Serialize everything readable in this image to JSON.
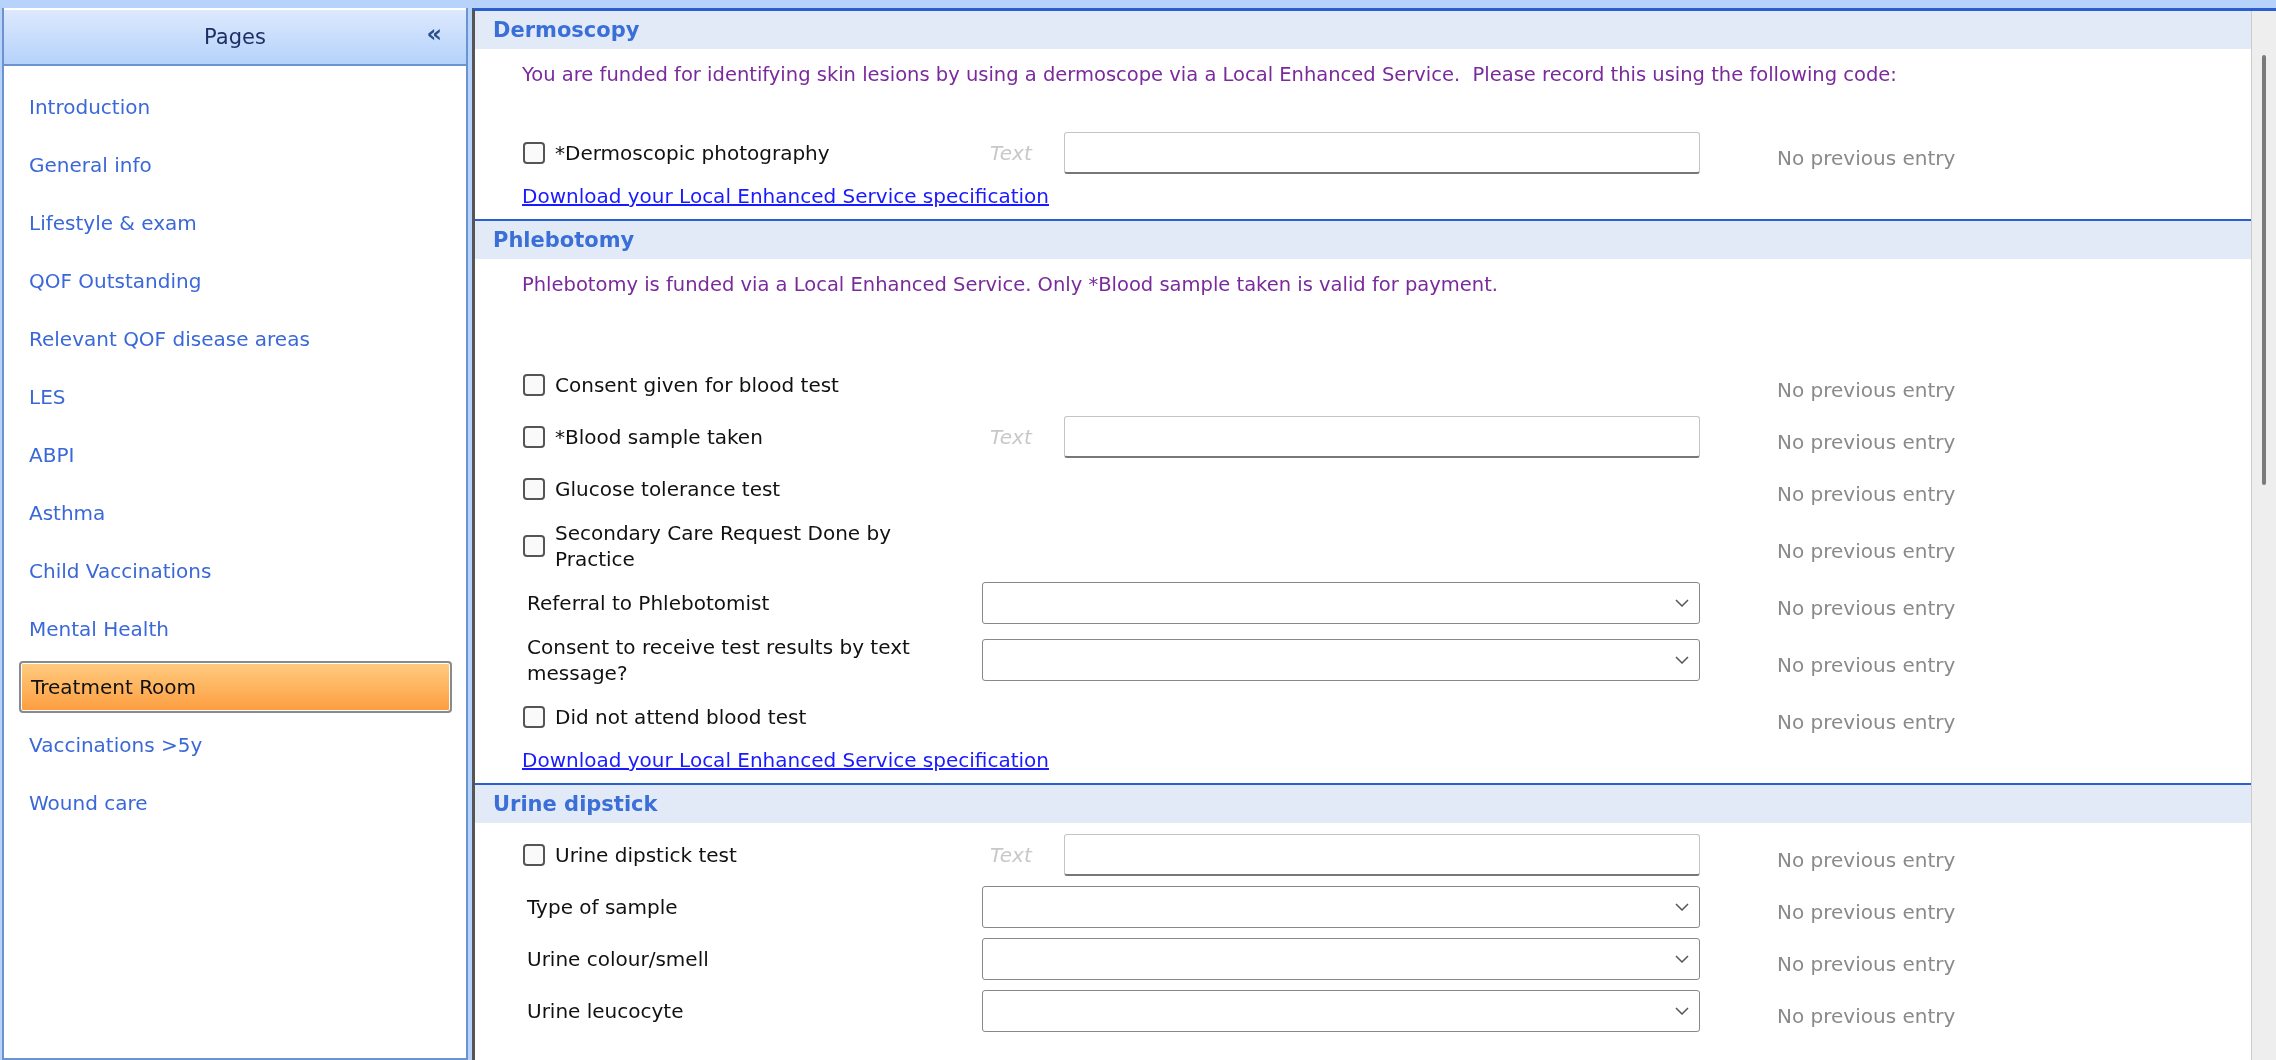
{
  "sidebar": {
    "title": "Pages",
    "collapse": "«",
    "items": [
      {
        "label": "Introduction",
        "selected": false
      },
      {
        "label": "General info",
        "selected": false
      },
      {
        "label": "Lifestyle & exam",
        "selected": false
      },
      {
        "label": "QOF Outstanding",
        "selected": false
      },
      {
        "label": "Relevant QOF disease areas",
        "selected": false
      },
      {
        "label": "LES",
        "selected": false
      },
      {
        "label": "ABPI",
        "selected": false
      },
      {
        "label": "Asthma",
        "selected": false
      },
      {
        "label": "Child Vaccinations",
        "selected": false
      },
      {
        "label": "Mental Health",
        "selected": false
      },
      {
        "label": "Treatment Room",
        "selected": true
      },
      {
        "label": "Vaccinations >5y",
        "selected": false
      },
      {
        "label": "Wound care",
        "selected": false
      }
    ]
  },
  "sections": [
    {
      "title": "Dermoscopy",
      "intro": "You are funded for identifying skin lesions by using a dermoscope via a Local Enhanced Service.  Please record this using the following code:",
      "rows": [
        {
          "kind": "check_text",
          "label": "*Dermoscopic photography",
          "checked": false,
          "placeholder": "Text",
          "previous": "No previous entry"
        }
      ],
      "link": "Download your Local Enhanced Service specification"
    },
    {
      "title": "Phlebotomy",
      "intro": "Phlebotomy is funded via a Local Enhanced Service. Only *Blood sample taken is valid for payment.",
      "rows": [
        {
          "kind": "check",
          "label": "Consent given for blood test",
          "checked": false,
          "previous": "No previous entry"
        },
        {
          "kind": "check_text",
          "label": "*Blood sample taken",
          "checked": false,
          "placeholder": "Text",
          "previous": "No previous entry"
        },
        {
          "kind": "check",
          "label": "Glucose tolerance test",
          "checked": false,
          "previous": "No previous entry"
        },
        {
          "kind": "check",
          "label": "Secondary Care Request Done by Practice",
          "checked": false,
          "previous": "No previous entry"
        },
        {
          "kind": "select",
          "label": "Referral to Phlebotomist",
          "previous": "No previous entry"
        },
        {
          "kind": "select",
          "label": "Consent to receive test results by text message?",
          "previous": "No previous entry"
        },
        {
          "kind": "check",
          "label": "Did not attend blood test",
          "checked": false,
          "previous": "No previous entry"
        }
      ],
      "link": "Download your Local Enhanced Service specification"
    },
    {
      "title": "Urine dipstick",
      "rows": [
        {
          "kind": "check_text",
          "label": "Urine dipstick test",
          "checked": false,
          "placeholder": "Text",
          "previous": "No previous entry"
        },
        {
          "kind": "select",
          "label": "Type of sample",
          "previous": "No previous entry"
        },
        {
          "kind": "select",
          "label": "Urine colour/smell",
          "previous": "No previous entry"
        },
        {
          "kind": "select",
          "label": "Urine leucocyte",
          "previous": "No previous entry"
        }
      ]
    }
  ]
}
